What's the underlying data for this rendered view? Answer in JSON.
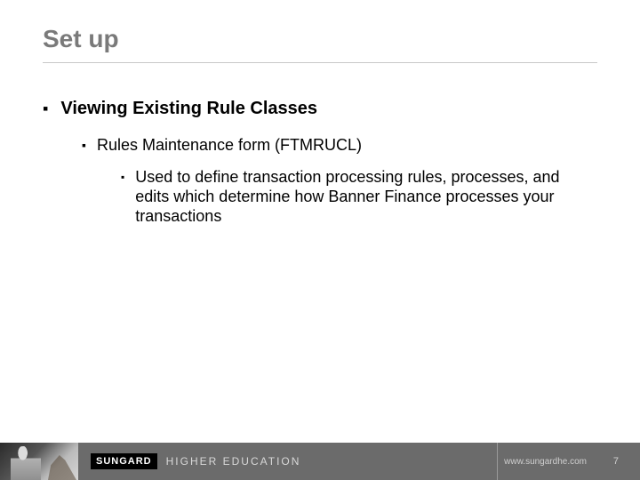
{
  "title": "Set up",
  "bullets": {
    "lvl1": "Viewing Existing Rule Classes",
    "lvl2": "Rules Maintenance form (FTMRUCL)",
    "lvl3": "Used to define transaction processing rules, processes, and edits which determine how Banner Finance processes your transactions"
  },
  "brand": {
    "mark": "SUNGARD",
    "sub": "HIGHER EDUCATION"
  },
  "footer": {
    "url": "www.sungardhe.com",
    "page": "7"
  }
}
